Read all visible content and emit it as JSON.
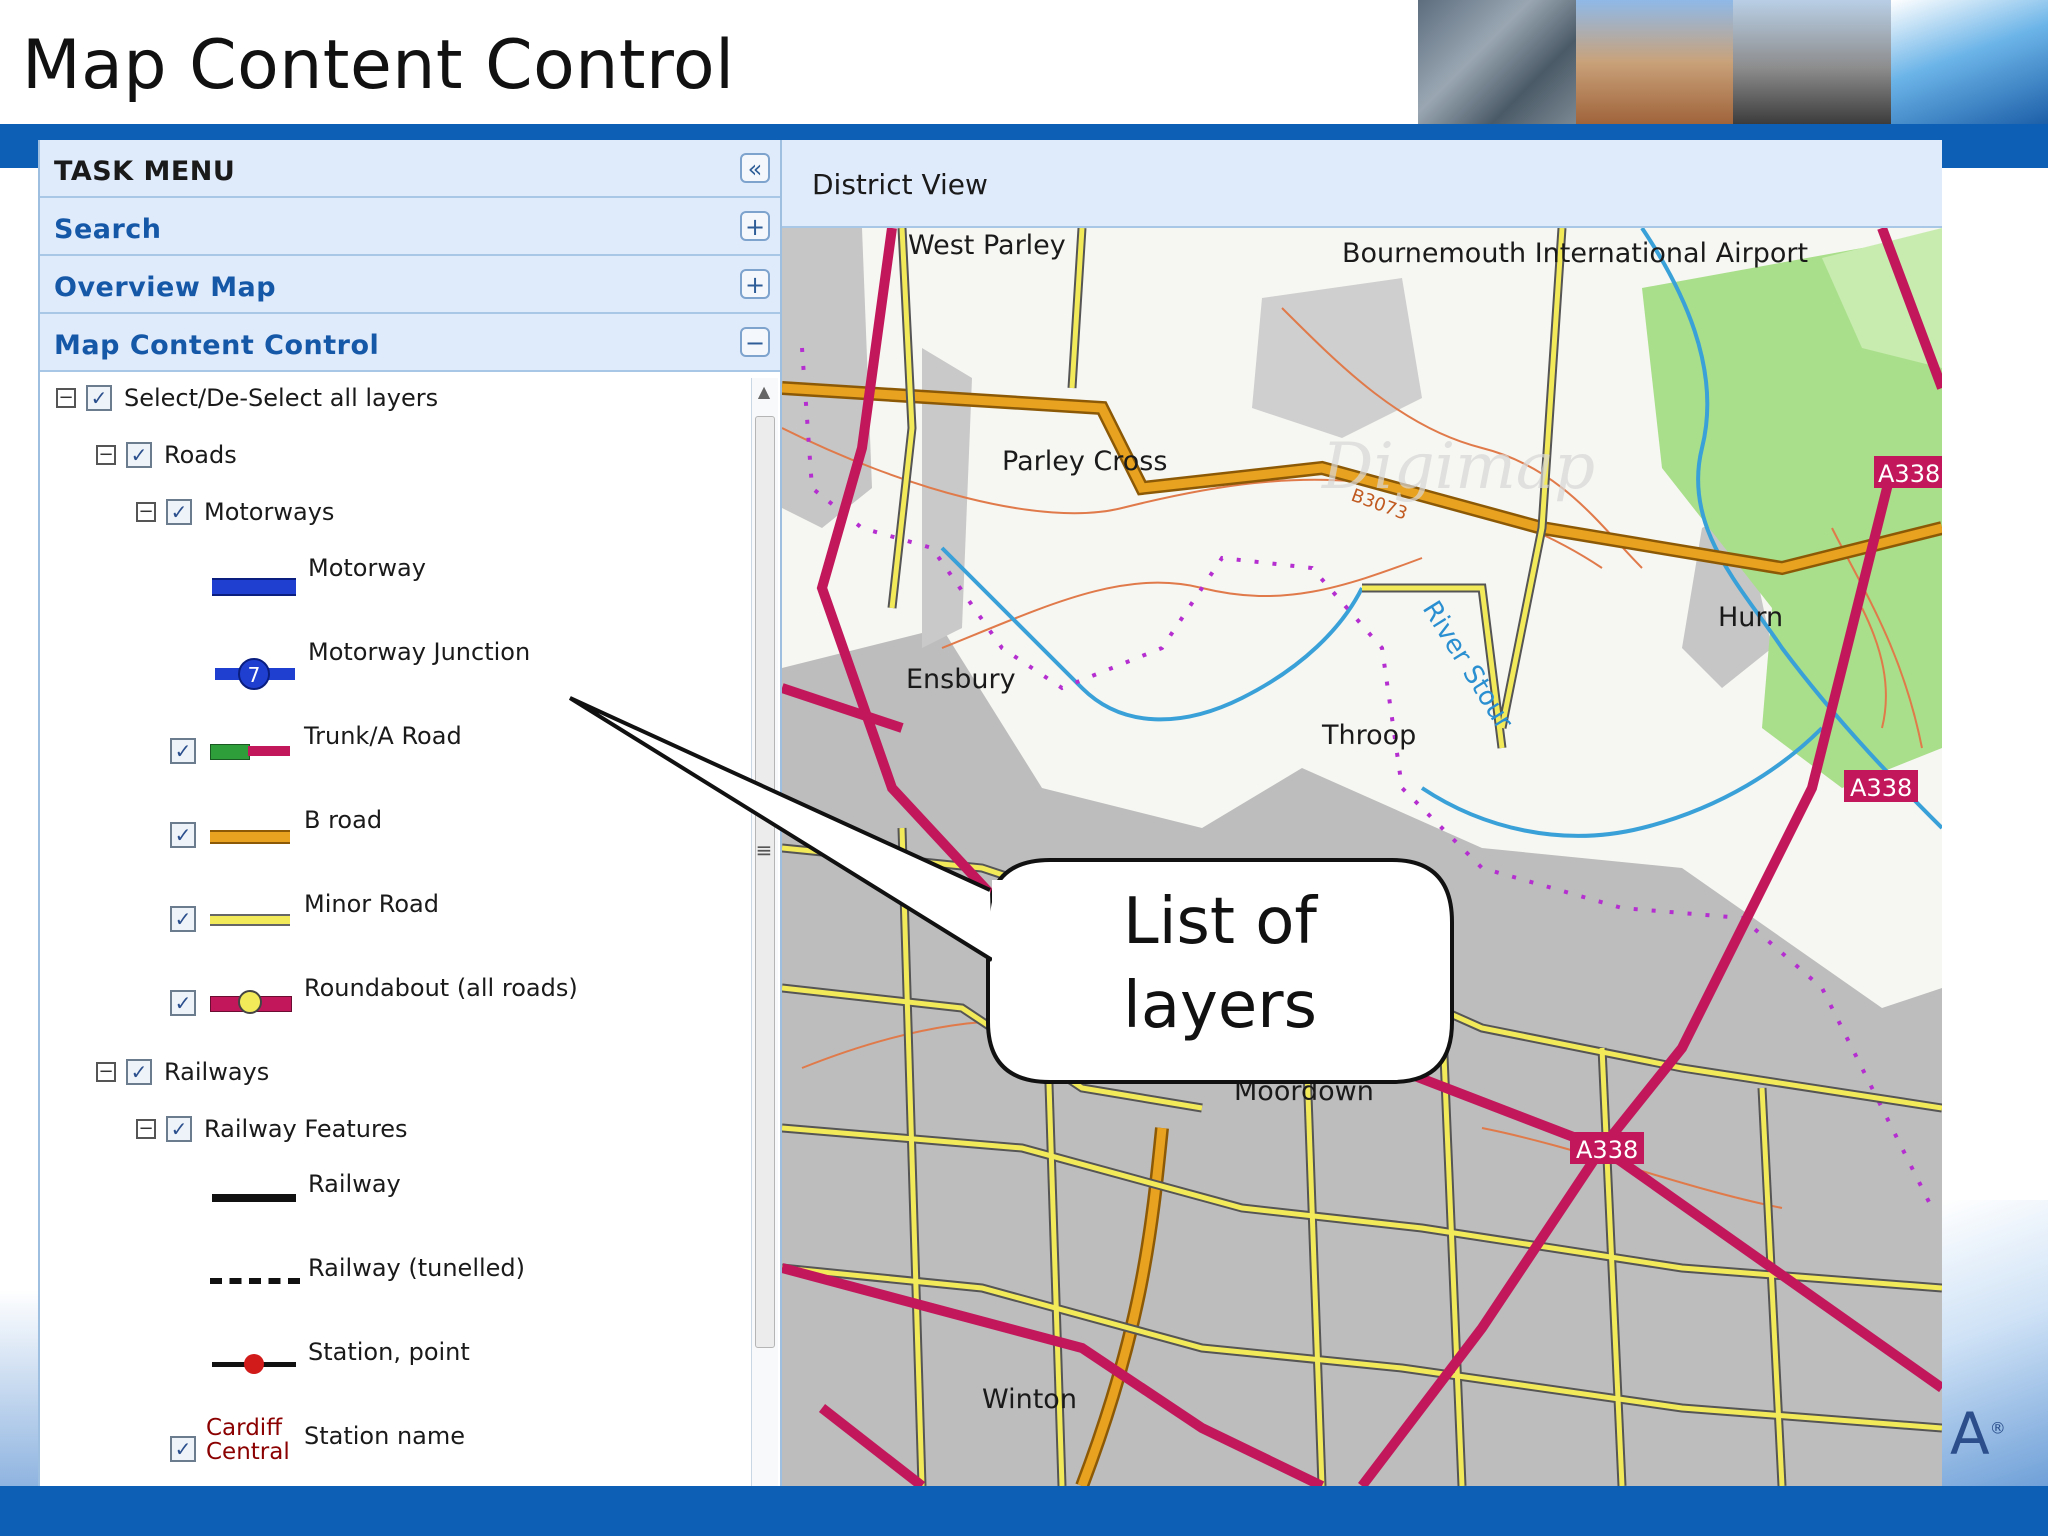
{
  "slide": {
    "title": "Map Content Control"
  },
  "panel": {
    "header": "TASK MENU",
    "collapse_symbol": "«",
    "sections": [
      {
        "label": "Search",
        "symbol": "+"
      },
      {
        "label": "Overview Map",
        "symbol": "+"
      },
      {
        "label": "Map Content Control",
        "symbol": "−"
      }
    ],
    "tree": {
      "select_all": "Select/De-Select all layers",
      "roads": "Roads",
      "motorways": "Motorways",
      "motorway": "Motorway",
      "motorway_junction": "Motorway Junction",
      "junction_number": "7",
      "trunk_a_road": "Trunk/A Road",
      "b_road": "B road",
      "minor_road": "Minor Road",
      "roundabout": "Roundabout (all roads)",
      "railways": "Railways",
      "railway_features": "Railway Features",
      "railway": "Railway",
      "railway_tunnelled": "Railway (tunelled)",
      "station_point": "Station, point",
      "station_name": "Station name",
      "station_sample_line1": "Cardiff",
      "station_sample_line2": "Central"
    }
  },
  "map": {
    "title": "District View",
    "places": {
      "west_parley": "West Parley",
      "airport": "Bournemouth International Airport",
      "parley_cross": "Parley Cross",
      "ensbury": "Ensbury",
      "throop": "Throop",
      "hurn": "Hurn",
      "moordown": "Moordown",
      "winton": "Winton",
      "river_stour": "River Stour",
      "watermark": "Digimap"
    },
    "road_labels": {
      "a338": "A338",
      "b3073": "B3073"
    },
    "colors": {
      "a_road": "#c2185b",
      "b_road": "#e8a21f",
      "minor_road": "#f3ea5a",
      "urban": "#bdbdbd",
      "woodland": "#a9df8a",
      "river": "#3aa0d8",
      "contour": "#e07a4a",
      "boundary": "#b52fd0"
    }
  },
  "callout": {
    "line1": "List of",
    "line2": "layers"
  },
  "brand": {
    "text": "A",
    "mark": "®"
  }
}
